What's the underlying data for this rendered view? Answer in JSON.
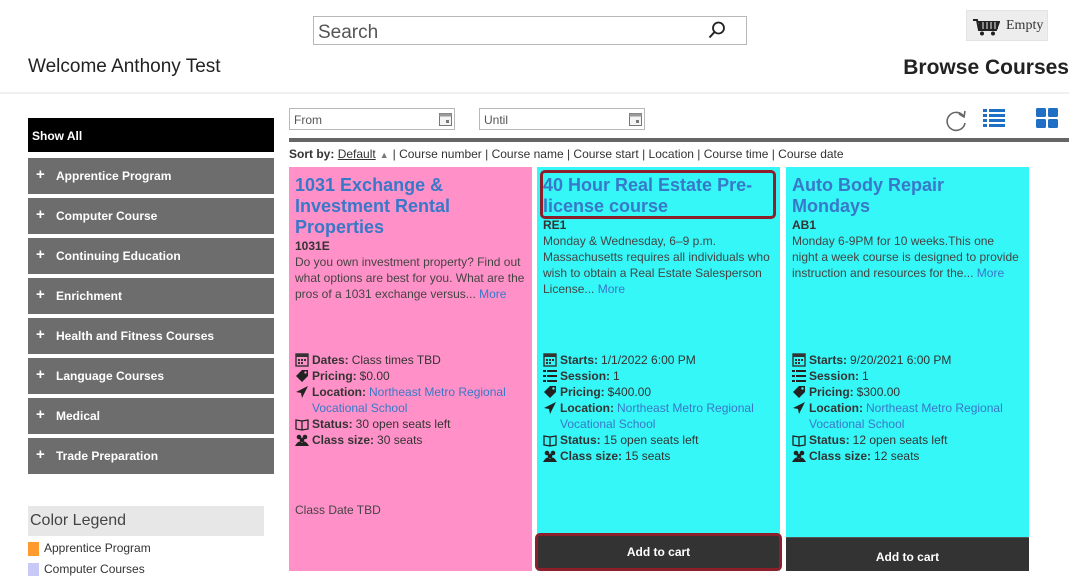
{
  "header": {
    "search_placeholder": "Search",
    "cart_label": "Empty",
    "welcome": "Welcome Anthony Test",
    "page_title": "Browse Courses"
  },
  "sidebar": {
    "show_all": "Show All",
    "categories": [
      "Apprentice Program",
      "Computer Course",
      "Continuing Education",
      "Enrichment",
      "Health and Fitness Courses",
      "Language Courses",
      "Medical",
      "Trade Preparation"
    ],
    "legend_title": "Color Legend",
    "legend": [
      {
        "label": "Apprentice Program",
        "color": "#ff9a2e"
      },
      {
        "label": "Computer Courses",
        "color": "#c9c9f7"
      }
    ]
  },
  "filters": {
    "from_label": "From",
    "until_label": "Until"
  },
  "sort": {
    "prefix": "Sort by:",
    "default": "Default",
    "options": "| Course number | Course name | Course start | Location | Course time | Course date"
  },
  "cards": [
    {
      "title": "1031 Exchange & Investment Rental Properties",
      "code": "1031E",
      "description": "Do you own investment property? Find out what options are best for you. What are the pros of a 1031 exchange versus...",
      "more": "More",
      "dates_label": "Dates:",
      "dates_value": "Class times TBD",
      "pricing_label": "Pricing:",
      "pricing_value": "$0.00",
      "location_label": "Location:",
      "location_value": "Northeast Metro Regional Vocational School",
      "status_label": "Status:",
      "status_value": "30 open seats left",
      "size_label": "Class size:",
      "size_value": "30 seats",
      "note": "Class Date TBD",
      "color": "#ff91c8"
    },
    {
      "title": "40 Hour Real Estate Pre-license course",
      "code": "RE1",
      "description": "Monday & Wednesday, 6–9 p.m. Massachusetts requires all individuals who wish to obtain a Real Estate Salesperson License...",
      "more": "More",
      "starts_label": "Starts:",
      "starts_value": "1/1/2022 6:00 PM",
      "session_label": "Session:",
      "session_value": "1",
      "pricing_label": "Pricing:",
      "pricing_value": "$400.00",
      "location_label": "Location:",
      "location_value": "Northeast Metro Regional Vocational School",
      "status_label": "Status:",
      "status_value": "15 open seats left",
      "size_label": "Class size:",
      "size_value": "15 seats",
      "add_to_cart": "Add to cart",
      "color": "#35f7f7"
    },
    {
      "title": "Auto Body Repair Mondays",
      "code": "AB1",
      "description": "Monday 6-9PM for 10 weeks.This one night a week course is designed to provide instruction and resources for the...",
      "more": "More",
      "starts_label": "Starts:",
      "starts_value": "9/20/2021 6:00 PM",
      "session_label": "Session:",
      "session_value": "1",
      "pricing_label": "Pricing:",
      "pricing_value": "$300.00",
      "location_label": "Location:",
      "location_value": "Northeast Metro Regional Vocational School",
      "status_label": "Status:",
      "status_value": "12 open seats left",
      "size_label": "Class size:",
      "size_value": "12 seats",
      "add_to_cart": "Add to cart",
      "color": "#35f7f7"
    }
  ]
}
